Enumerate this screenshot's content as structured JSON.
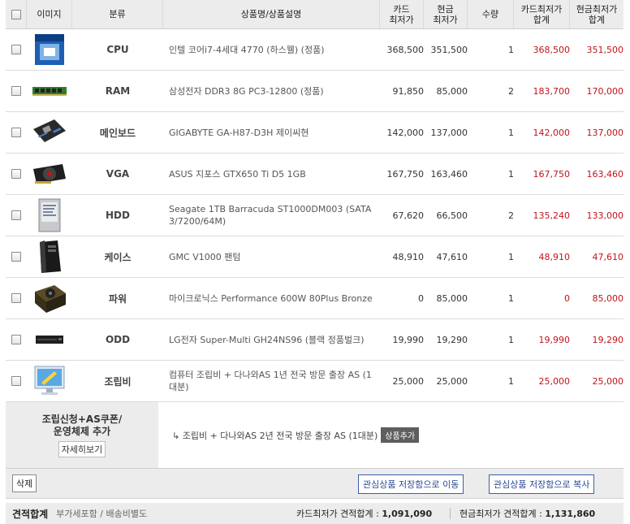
{
  "header": {
    "checkbox": "",
    "image": "이미지",
    "category": "분류",
    "name": "상품명/상품설명",
    "card_price": "카드\n최저가",
    "cash_price": "현금\n최저가",
    "qty": "수량",
    "card_total": "카드최저가\n합계",
    "cash_total": "현금최저가\n합계"
  },
  "rows": [
    {
      "category": "CPU",
      "name": "인텔 코어i7-4세대 4770 (하스웰) (정품)",
      "card": "368,500",
      "cash": "351,500",
      "qty": "1",
      "card_total": "368,500",
      "cash_total": "351,500",
      "icon": "cpu-box-icon"
    },
    {
      "category": "RAM",
      "name": "삼성전자 DDR3 8G PC3-12800 (정품)",
      "card": "91,850",
      "cash": "85,000",
      "qty": "2",
      "card_total": "183,700",
      "cash_total": "170,000",
      "icon": "ram-stick-icon"
    },
    {
      "category": "메인보드",
      "name": "GIGABYTE GA-H87-D3H 제이씨현",
      "card": "142,000",
      "cash": "137,000",
      "qty": "1",
      "card_total": "142,000",
      "cash_total": "137,000",
      "icon": "motherboard-icon"
    },
    {
      "category": "VGA",
      "name": "ASUS 지포스 GTX650 Ti D5 1GB",
      "card": "167,750",
      "cash": "163,460",
      "qty": "1",
      "card_total": "167,750",
      "cash_total": "163,460",
      "icon": "graphics-card-icon"
    },
    {
      "category": "HDD",
      "name": "Seagate 1TB Barracuda ST1000DM003 (SATA 3/7200/64M)",
      "card": "67,620",
      "cash": "66,500",
      "qty": "2",
      "card_total": "135,240",
      "cash_total": "133,000",
      "icon": "hard-drive-icon"
    },
    {
      "category": "케이스",
      "name": "GMC V1000 팬텀",
      "card": "48,910",
      "cash": "47,610",
      "qty": "1",
      "card_total": "48,910",
      "cash_total": "47,610",
      "icon": "pc-case-icon"
    },
    {
      "category": "파워",
      "name": "마이크로닉스 Performance 600W 80Plus Bronze",
      "card": "0",
      "cash": "85,000",
      "qty": "1",
      "card_total": "0",
      "cash_total": "85,000",
      "icon": "power-supply-icon"
    },
    {
      "category": "ODD",
      "name": "LG전자 Super-Multi GH24NS96 (블랙 정품벌크)",
      "card": "19,990",
      "cash": "19,290",
      "qty": "1",
      "card_total": "19,990",
      "cash_total": "19,290",
      "icon": "optical-drive-icon"
    },
    {
      "category": "조립비",
      "name": "컴퓨터 조립비 + 다나와AS 1년 전국 방문 출장 AS (1대분)",
      "card": "25,000",
      "cash": "25,000",
      "qty": "1",
      "card_total": "25,000",
      "cash_total": "25,000",
      "icon": "assembly-monitor-icon"
    }
  ],
  "extra": {
    "title": "조립신청+AS쿠폰/\n운영체제 추가",
    "detail_label": "자세히보기",
    "option_text": "↳ 조립비 + 다나와AS 2년 전국 방문 출장 AS (1대분)",
    "add_label": "상품추가"
  },
  "actions": {
    "delete_label": "삭제",
    "move_label": "관심상품 저장함으로 이동",
    "copy_label": "관심상품 저장함으로 복사"
  },
  "total": {
    "label": "견적합계",
    "sub": "부가세포함 / 배송비별도",
    "card_label": "카드최저가 견적합계 : ",
    "card_value": "1,091,090",
    "cash_label": "현금최저가 견적합계 : ",
    "cash_value": "1,131,860"
  },
  "colors": {
    "header_bg": "#ececec",
    "total_red": "#c0141b",
    "button_blue": "#2b4a91"
  }
}
